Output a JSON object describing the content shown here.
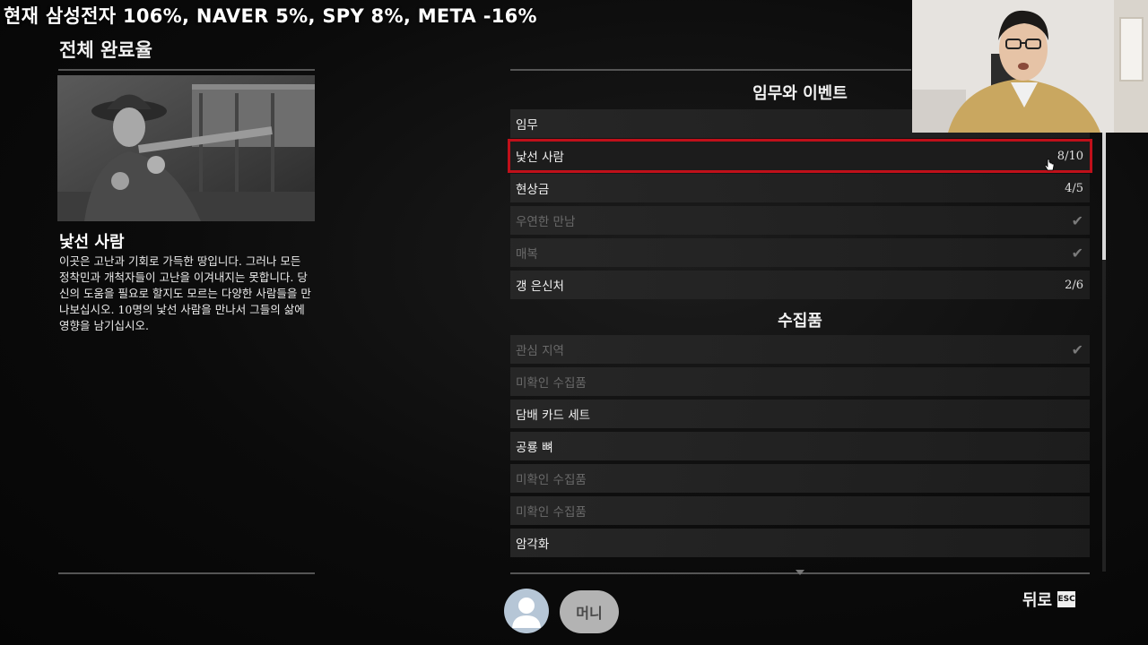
{
  "overlay": {
    "headline": "현재 삼성전자 106%, NAVER 5%, SPY 8%, META -16%"
  },
  "page": {
    "title": "전체 완료율"
  },
  "side_panel": {
    "title": "낯선 사람",
    "description": "이곳은 고난과 기회로 가득한 땅입니다. 그러나 모든 정착민과 개척자들이 고난을 이겨내지는 못합니다. 당신의 도움을 필요로 할지도 모르는 다양한 사람들을 만나보십시오. 10명의 낯선 사람을 만나서 그들의 삶에 영향을 남기십시오."
  },
  "sections": {
    "missions": {
      "title": "임무와 이벤트",
      "items": [
        {
          "label": "임무",
          "value": "",
          "dim": false,
          "check": false
        },
        {
          "label": "낯선 사람",
          "value": "8/10",
          "dim": false,
          "check": false,
          "selected": true
        },
        {
          "label": "현상금",
          "value": "4/5",
          "dim": false,
          "check": false
        },
        {
          "label": "우연한 만남",
          "value": "",
          "dim": true,
          "check": true
        },
        {
          "label": "매복",
          "value": "",
          "dim": true,
          "check": true
        },
        {
          "label": "갱 은신처",
          "value": "2/6",
          "dim": false,
          "check": false
        }
      ]
    },
    "collectibles": {
      "title": "수집품",
      "items": [
        {
          "label": "관심 지역",
          "value": "",
          "dim": true,
          "check": true
        },
        {
          "label": "미확인 수집품",
          "value": "",
          "dim": true,
          "check": false
        },
        {
          "label": "담배 카드 세트",
          "value": "",
          "dim": false,
          "check": false
        },
        {
          "label": "공룡 뼈",
          "value": "",
          "dim": false,
          "check": false
        },
        {
          "label": "미확인 수집품",
          "value": "",
          "dim": true,
          "check": false
        },
        {
          "label": "미확인 수집품",
          "value": "",
          "dim": true,
          "check": false
        },
        {
          "label": "암각화",
          "value": "",
          "dim": false,
          "check": false
        }
      ]
    }
  },
  "footer": {
    "money_label": "머니",
    "back_label": "뒤로",
    "esc_key": "ESC"
  },
  "icons": {
    "check": "checkmark-icon",
    "avatar": "user-avatar-icon",
    "cursor": "hand-cursor-icon"
  },
  "colors": {
    "selection": "#c0101a",
    "background": "#0a0a0a",
    "dim_text": "#6a6a6a"
  }
}
